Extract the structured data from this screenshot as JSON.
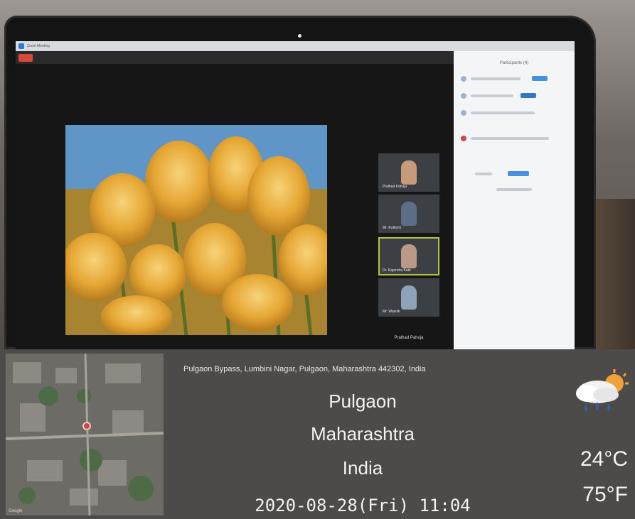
{
  "window": {
    "title": "Zoom Meeting"
  },
  "meeting": {
    "participants_panel_title": "Participants (4)",
    "participants": [
      {
        "name": "Pralhad Pahuja"
      },
      {
        "name": "Mr. Kulkarni"
      },
      {
        "name": "Dr. Rajendra Kute"
      },
      {
        "name": "Mr. Wasnik"
      }
    ],
    "active_speaker_name": "Pralhad Pahuja",
    "shared_content": "tulips-image"
  },
  "geotag": {
    "address": "Pulgaon Bypass, Lumbini Nagar, Pulgaon, Maharashtra 442302, India",
    "city": "Pulgaon",
    "state": "Maharashtra",
    "country": "India",
    "datetime": "2020-08-28(Fri)  11:04",
    "temp_c": "24°C",
    "temp_f": "75°F",
    "weather_icon": "cloud-rain-sun-icon",
    "map_credit": "Google"
  },
  "colors": {
    "overlay_bg": "#4c4b49",
    "active_tile_border": "#b4c43c",
    "pin": "#c84a4a"
  }
}
